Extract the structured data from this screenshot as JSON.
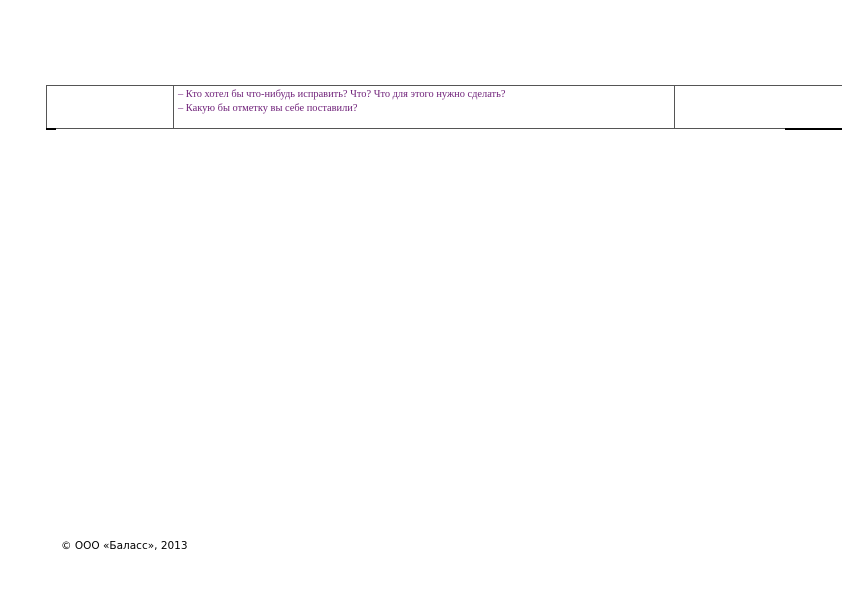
{
  "table": {
    "questions": [
      "– Кто хотел бы что-нибудь исправить? Что? Что для этого нужно сделать?",
      "– Какую бы отметку вы себе поставили?"
    ]
  },
  "footer": {
    "copyright": "© ООО «Баласс», 2013"
  },
  "colors": {
    "question_text": "#6e1f78",
    "border": "#555555"
  }
}
